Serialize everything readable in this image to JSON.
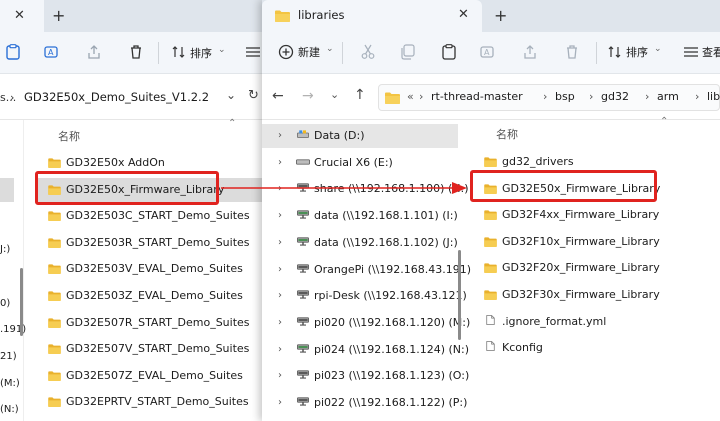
{
  "left": {
    "toolbar": {
      "sort_label": "排序"
    },
    "address": {
      "path_tail": "GD32E50x_Demo_Suites_V1.2.2",
      "prefix": "s..."
    },
    "column_header": "名称",
    "items": [
      {
        "label": "GD32E50x AddOn"
      },
      {
        "label": "GD32E50x_Firmware_Library"
      },
      {
        "label": "GD32E503C_START_Demo_Suites"
      },
      {
        "label": "GD32E503R_START_Demo_Suites"
      },
      {
        "label": "GD32E503V_EVAL_Demo_Suites"
      },
      {
        "label": "GD32E503Z_EVAL_Demo_Suites"
      },
      {
        "label": "GD32E507R_START_Demo_Suites"
      },
      {
        "label": "GD32E507V_START_Demo_Suites"
      },
      {
        "label": "GD32E507Z_EVAL_Demo_Suites"
      },
      {
        "label": "GD32EPRTV_START_Demo_Suites"
      }
    ],
    "nav_fragments": [
      "J:)",
      "0)",
      ".191)",
      "21)",
      "(M:)",
      "(N:)"
    ]
  },
  "right": {
    "tab_title": "libraries",
    "toolbar": {
      "new_label": "新建",
      "sort_label": "排序",
      "view_label": "查看"
    },
    "breadcrumb": [
      "rt-thread-master",
      "bsp",
      "gd32",
      "arm",
      "libraries"
    ],
    "breadcrumb_prefix": "«",
    "column_header": "名称",
    "nav": [
      {
        "label": "Data (D:)",
        "drive": "data-drive"
      },
      {
        "label": "Crucial X6 (E:)",
        "drive": "usb-drive"
      },
      {
        "label": "share (\\\\192.168.1.100) (H:)",
        "drive": "network-drive"
      },
      {
        "label": "data (\\\\192.168.1.101) (I:)",
        "drive": "network-drive-green"
      },
      {
        "label": "data (\\\\192.168.1.102) (J:)",
        "drive": "network-drive-green"
      },
      {
        "label": "OrangePi (\\\\192.168.43.191)",
        "drive": "network-drive"
      },
      {
        "label": "rpi-Desk (\\\\192.168.43.121)",
        "drive": "network-drive"
      },
      {
        "label": "pi020 (\\\\192.168.1.120) (M:)",
        "drive": "network-drive"
      },
      {
        "label": "pi024 (\\\\192.168.1.124) (N:)",
        "drive": "network-drive-green"
      },
      {
        "label": "pi023 (\\\\192.168.1.123) (O:)",
        "drive": "network-drive"
      },
      {
        "label": "pi022 (\\\\192.168.1.122) (P:)",
        "drive": "network-drive"
      }
    ],
    "items": [
      {
        "label": "gd32_drivers",
        "kind": "folder"
      },
      {
        "label": "GD32E50x_Firmware_Library",
        "kind": "folder"
      },
      {
        "label": "GD32F4xx_Firmware_Library",
        "kind": "folder"
      },
      {
        "label": "GD32F10x_Firmware_Library",
        "kind": "folder"
      },
      {
        "label": "GD32F20x_Firmware_Library",
        "kind": "folder"
      },
      {
        "label": "GD32F30x_Firmware_Library",
        "kind": "folder"
      },
      {
        "label": ".ignore_format.yml",
        "kind": "file"
      },
      {
        "label": "Kconfig",
        "kind": "file"
      }
    ]
  },
  "colors": {
    "highlight": "#e0231f",
    "folder": "#f3c443",
    "folder_dark": "#d9a21b",
    "selected_row": "#dcdcdc"
  }
}
